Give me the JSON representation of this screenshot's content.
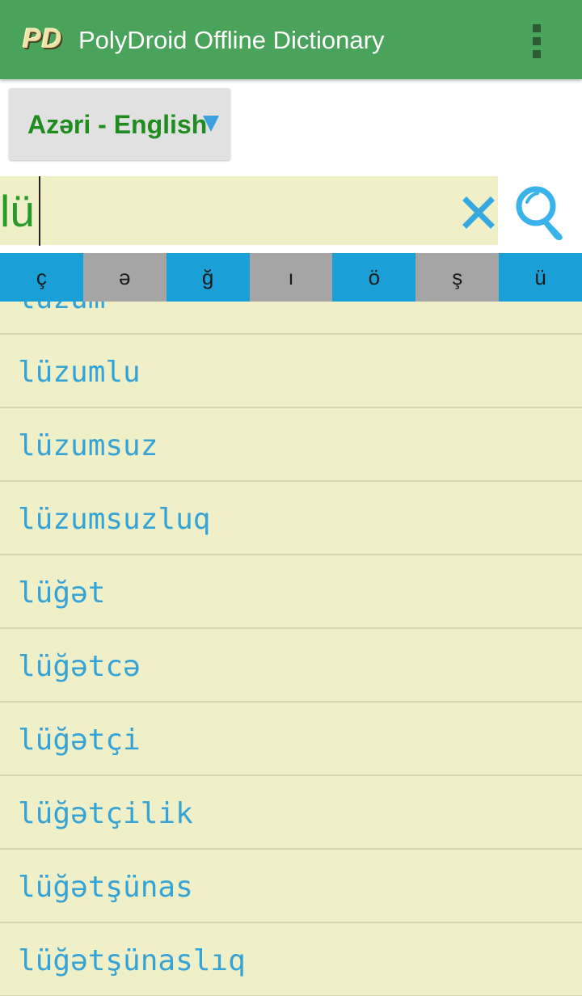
{
  "app_bar": {
    "logo": "PD",
    "title": "PolyDroid Offline Dictionary",
    "menu_icon": "overflow-menu-icon"
  },
  "language_selector": {
    "label": "Azəri - English",
    "arrow_icon": "dropdown-triangle-icon"
  },
  "search": {
    "value": "lü",
    "clear_icon": "close-x-icon",
    "search_icon": "magnifier-icon"
  },
  "char_bar": {
    "keys": [
      "ç",
      "ə",
      "ğ",
      "ı",
      "ö",
      "ş",
      "ü"
    ]
  },
  "results": [
    "lüzum",
    "lüzumlu",
    "lüzumsuz",
    "lüzumsuzluq",
    "lüğət",
    "lüğətcə",
    "lüğətçi",
    "lüğətçilik",
    "lüğətşünas",
    "lüğətşünaslıq"
  ],
  "colors": {
    "app_bar": "#4aa35a",
    "accent_blue": "#1aa0d6",
    "key_gray": "#a5a5a5",
    "list_bg": "#efefc8",
    "result_text": "#36a3d6",
    "language_text": "#1f8c1f"
  }
}
